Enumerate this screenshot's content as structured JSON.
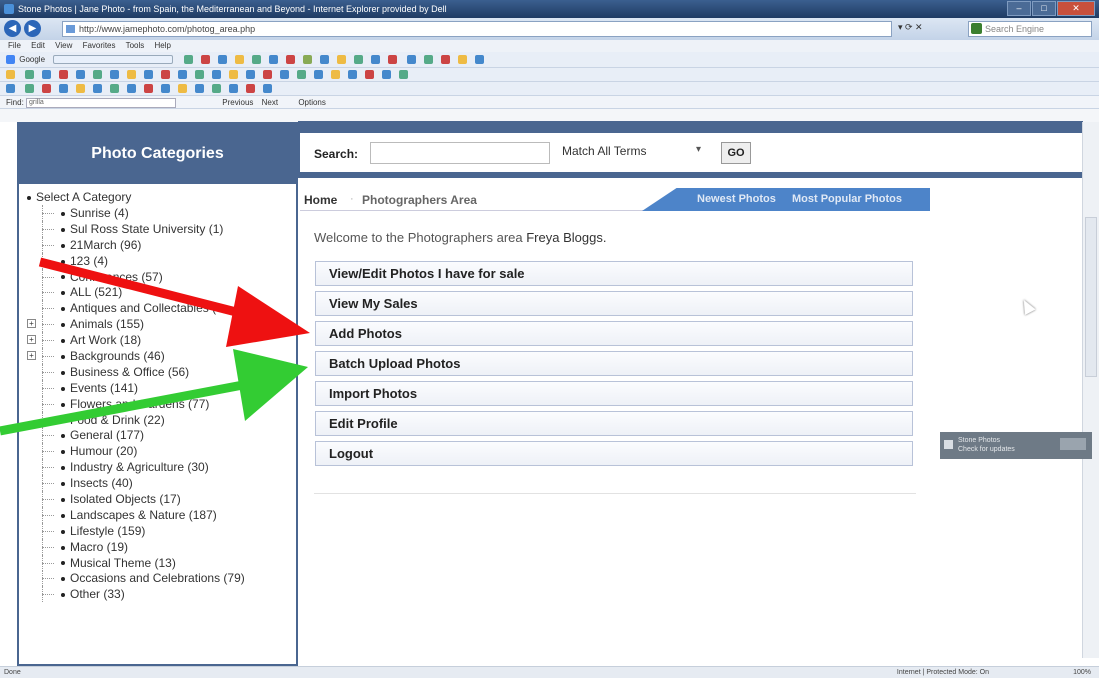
{
  "browser": {
    "title": "Stone Photos | Jane Photo - from Spain, the Mediterranean and Beyond - Internet Explorer provided by Dell",
    "url": "http://www.jamephoto.com/photog_area.php",
    "search_placeholder": "Search Engine",
    "menu": [
      "File",
      "Edit",
      "View",
      "Favorites",
      "Tools",
      "Help"
    ],
    "toolbar_google": "Google",
    "find_label": "Find:",
    "find_value": "grilla",
    "find_prev": "Previous",
    "find_next": "Next",
    "find_options": "Options",
    "status_left": "Done",
    "status_zone": "Internet | Protected Mode: On",
    "zoom": "100%"
  },
  "sidebar": {
    "title": "Photo Categories",
    "root": "Select A Category",
    "items": [
      {
        "label": "Sunrise (4)",
        "expandable": false
      },
      {
        "label": "Sul Ross State University (1)",
        "expandable": false
      },
      {
        "label": "21March (96)",
        "expandable": false
      },
      {
        "label": "123 (4)",
        "expandable": false
      },
      {
        "label": "Conferences (57)",
        "expandable": false
      },
      {
        "label": "ALL (521)",
        "expandable": false
      },
      {
        "label": "Antiques and Collectables (",
        "expandable": false
      },
      {
        "label": "Animals (155)",
        "expandable": true
      },
      {
        "label": "Art Work (18)",
        "expandable": true
      },
      {
        "label": "Backgrounds (46)",
        "expandable": true
      },
      {
        "label": "Business & Office (56)",
        "expandable": false
      },
      {
        "label": "Events (141)",
        "expandable": false
      },
      {
        "label": "Flowers and Gardens (77)",
        "expandable": false
      },
      {
        "label": "Food & Drink (22)",
        "expandable": false
      },
      {
        "label": "General (177)",
        "expandable": false
      },
      {
        "label": "Humour (20)",
        "expandable": false
      },
      {
        "label": "Industry & Agriculture (30)",
        "expandable": false
      },
      {
        "label": "Insects (40)",
        "expandable": false
      },
      {
        "label": "Isolated Objects (17)",
        "expandable": false
      },
      {
        "label": "Landscapes & Nature (187)",
        "expandable": false
      },
      {
        "label": "Lifestyle (159)",
        "expandable": false
      },
      {
        "label": "Macro (19)",
        "expandable": false
      },
      {
        "label": "Musical Theme (13)",
        "expandable": false
      },
      {
        "label": "Occasions and Celebrations (79)",
        "expandable": false
      },
      {
        "label": "Other (33)",
        "expandable": false
      }
    ]
  },
  "search": {
    "label": "Search:",
    "value": "",
    "match_option": "Match All Terms",
    "go_label": "GO"
  },
  "breadcrumb": {
    "home": "Home",
    "separator": "·",
    "current": "Photographers Area",
    "tab_newest": "Newest Photos",
    "tab_popular": "Most Popular Photos"
  },
  "main": {
    "welcome_text": "Welcome to the Photographers area",
    "user_name": "Freya Bloggs.",
    "menu": [
      "View/Edit Photos I have for sale",
      "View My Sales",
      "Add Photos",
      "Batch Upload Photos",
      "Import Photos",
      "Edit Profile",
      "Logout"
    ]
  },
  "widget": {
    "title": "Stone Photos",
    "subtitle": "Check for updates"
  },
  "colors": {
    "brand_blue": "#4a6690",
    "tab_blue": "#4d84c9",
    "arrow_red": "#ee1111",
    "arrow_green": "#33cc33"
  }
}
